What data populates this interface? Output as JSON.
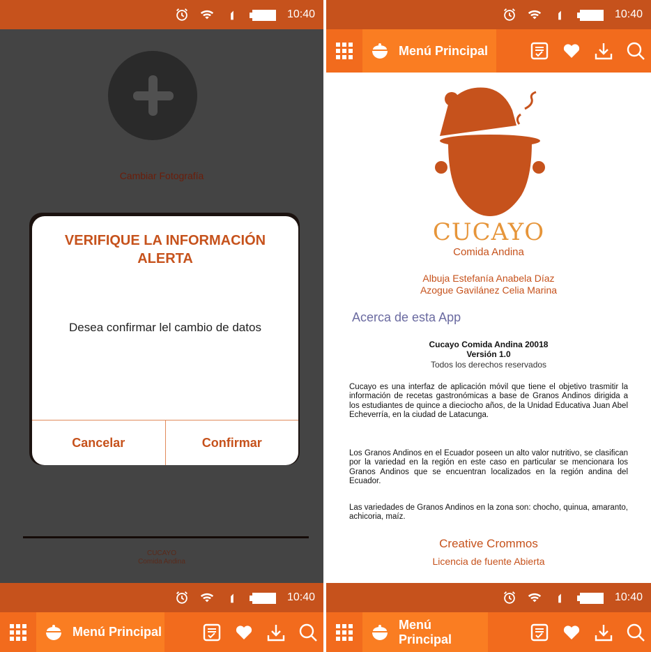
{
  "colors": {
    "status_bar": "#c6521c",
    "toolbar": "#f26b1d",
    "toolbar_active_tab": "#fa7d22",
    "accent": "#c6521c",
    "dark_background": "#444444"
  },
  "status_bar": {
    "time": "10:40",
    "icons": [
      "alarm-icon",
      "wifi-icon",
      "signal-icon",
      "battery-icon"
    ]
  },
  "toolbar": {
    "menu_label": "Menú Principal",
    "icons": [
      "apps-grid-icon",
      "cooking-pot-icon",
      "recipe-list-icon",
      "heart-icon",
      "download-icon",
      "search-icon"
    ]
  },
  "profile_screen": {
    "change_photo_label": "Cambiar Fotografía",
    "dialog": {
      "title_line1": "VERIFIQUE LA INFORMACIÓN",
      "title_line2": "ALERTA",
      "message": "Desea confirmar lel cambio de datos",
      "cancel_label": "Cancelar",
      "confirm_label": "Confirmar"
    },
    "footer_line1": "CUCAYO",
    "footer_line2": "Comida Andina"
  },
  "about_screen": {
    "brand_name": "CUCAYO",
    "brand_subtitle": "Comida Andina",
    "author1": "Albuja Estefanía Anabela Díaz",
    "author2": "Azogue Gavilánez Celia Marina",
    "about_heading": "Acerca de esta App",
    "app_name": "Cucayo Comida Andina 20018",
    "app_version": "Versión 1.0",
    "app_rights": "Todos los derechos reservados",
    "paragraph1": "Cucayo es una interfaz de aplicación móvil que tiene el objetivo trasmitir la información de recetas gastronómicas a base de Granos Andinos dirigida a los estudiantes de quince a dieciocho años, de la Unidad Educativa Juan Abel Echeverría, en la ciudad de Latacunga.",
    "paragraph2": "Los Granos Andinos en el Ecuador poseen un alto valor nutritivo, se clasifican por la variedad en la región en este caso en particular se mencionara los Granos Andinos que se encuentran localizados en la región andina del Ecuador.",
    "paragraph3": "Las variedades de Granos Andinos en la zona son: chocho, quinua, amaranto,  achicoria, maíz.",
    "license_title": "Creative Crommos",
    "license_subtitle": "Licencia de fuente Abierta"
  }
}
